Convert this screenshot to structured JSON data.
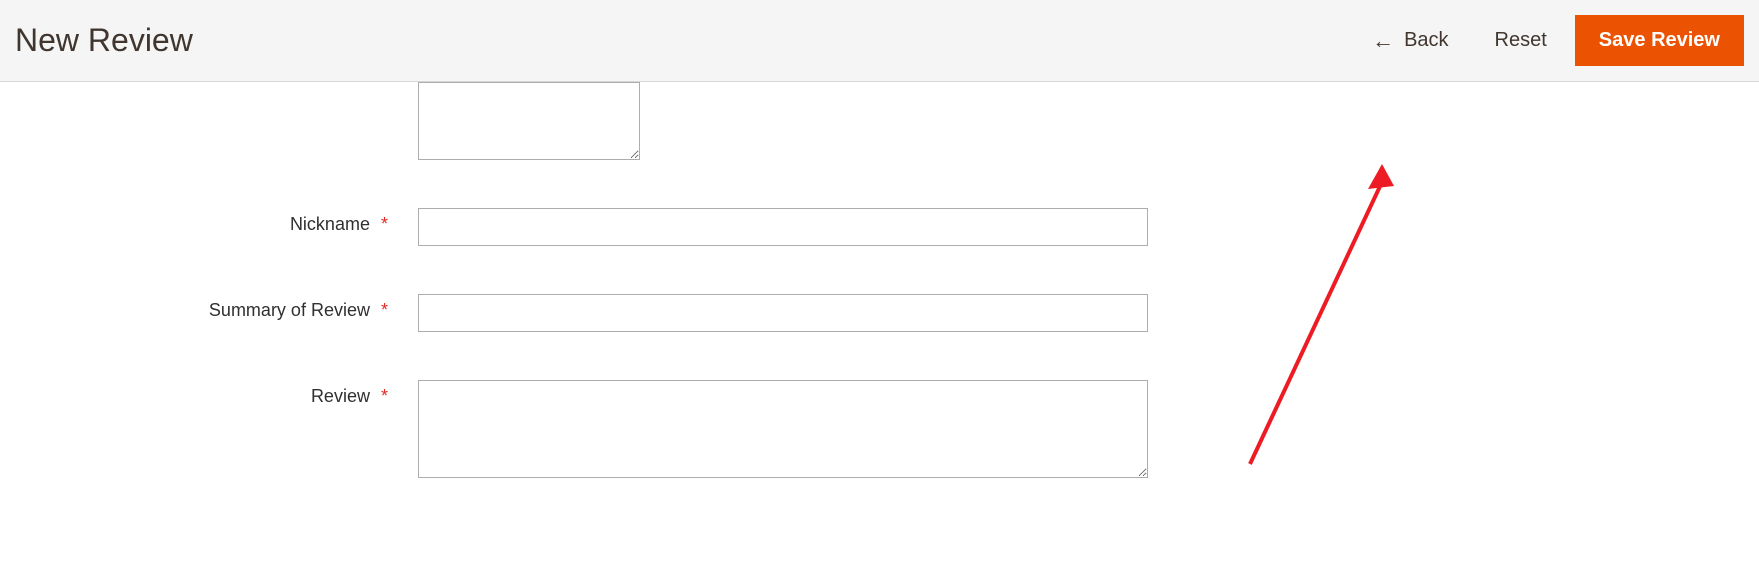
{
  "header": {
    "title": "New Review",
    "back_label": "Back",
    "reset_label": "Reset",
    "save_label": "Save Review"
  },
  "form": {
    "nickname_label": "Nickname",
    "nickname_value": "",
    "summary_label": "Summary of Review",
    "summary_value": "",
    "review_label": "Review",
    "review_value": "",
    "top_textarea_value": ""
  },
  "required_mark": "*",
  "colors": {
    "primary": "#eb5202",
    "required": "#e02b27",
    "arrow": "#ed1c24"
  }
}
